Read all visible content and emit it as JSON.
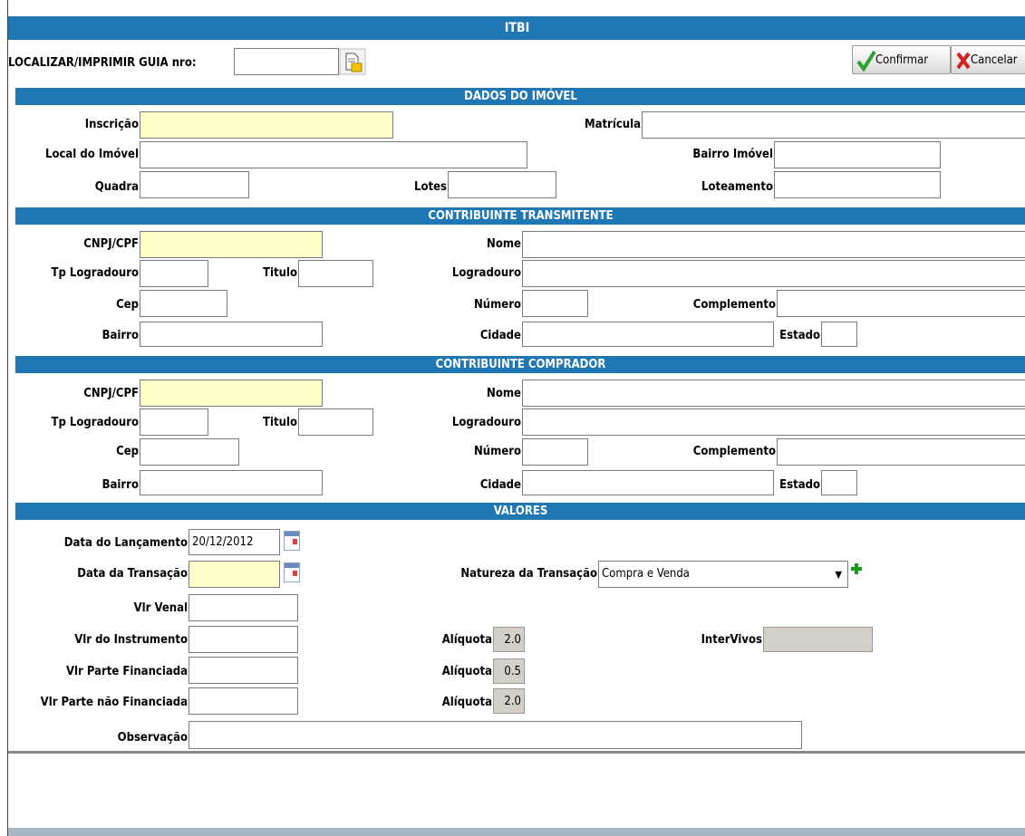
{
  "window": {
    "title": "ITBI"
  },
  "toolbar": {
    "locate_label": "LOCALIZAR/IMPRIMIR GUIA nro:",
    "guide_number": "",
    "confirm_label": "Confirmar",
    "cancel_label": "Cancelar"
  },
  "sections": {
    "imovel": "DADOS DO IMÓVEL",
    "transmitente": "CONTRIBUINTE TRANSMITENTE",
    "comprador": "CONTRIBUINTE COMPRADOR",
    "valores": "VALORES"
  },
  "imovel": {
    "inscricao_label": "Inscrição",
    "inscricao": "",
    "matricula_label": "Matrícula",
    "matricula": "",
    "local_label": "Local do Imóvel",
    "local": "",
    "bairro_label": "Bairro Imóvel",
    "bairro": "",
    "quadra_label": "Quadra",
    "quadra": "",
    "lotes_label": "Lotes",
    "lotes": "",
    "loteamento_label": "Loteamento",
    "loteamento": ""
  },
  "transmitente": {
    "cnpj_label": "CNPJ/CPF",
    "cnpj": "",
    "nome_label": "Nome",
    "nome": "",
    "tp_logradouro_label": "Tp Logradouro",
    "tp_logradouro": "",
    "titulo_label": "Titulo",
    "titulo": "",
    "logradouro_label": "Logradouro",
    "logradouro": "",
    "cep_label": "Cep",
    "cep": "",
    "numero_label": "Número",
    "numero": "",
    "complemento_label": "Complemento",
    "complemento": "",
    "bairro_label": "Bairro",
    "bairro": "",
    "cidade_label": "Cidade",
    "cidade": "",
    "estado_label": "Estado",
    "estado": ""
  },
  "comprador": {
    "cnpj_label": "CNPJ/CPF",
    "cnpj": "",
    "nome_label": "Nome",
    "nome": "",
    "tp_logradouro_label": "Tp Logradouro",
    "tp_logradouro": "",
    "titulo_label": "Titulo",
    "titulo": "",
    "logradouro_label": "Logradouro",
    "logradouro": "",
    "cep_label": "Cep",
    "cep": "",
    "numero_label": "Número",
    "numero": "",
    "complemento_label": "Complemento",
    "complemento": "",
    "bairro_label": "Bairro",
    "bairro": "",
    "cidade_label": "Cidade",
    "cidade": "",
    "estado_label": "Estado",
    "estado": ""
  },
  "valores": {
    "data_lancamento_label": "Data do Lançamento",
    "data_lancamento": "20/12/2012",
    "data_transacao_label": "Data da Transação",
    "data_transacao": "",
    "natureza_label": "Natureza da Transação",
    "natureza": "Compra e Venda",
    "vlr_venal_label": "Vlr Venal",
    "vlr_venal": "",
    "vlr_instrumento_label": "Vlr do Instrumento",
    "vlr_instrumento": "",
    "vlr_financiada_label": "Vlr Parte Financiada",
    "vlr_financiada": "",
    "vlr_nao_financiada_label": "Vlr Parte não Financiada",
    "vlr_nao_financiada": "",
    "aliquota_label": "Alíquota",
    "aliquota_1": "2.0",
    "aliquota_2": "0.5",
    "aliquota_3": "2.0",
    "intervivos_label": "InterVivos",
    "intervivos": "",
    "observacao_label": "Observação",
    "observacao": ""
  },
  "colors": {
    "header_blue": "#1f78b4",
    "required_yellow": "#ffffcc",
    "readonly_gray": "#d4d0c8"
  },
  "icons": [
    "search-doc-icon",
    "check-icon",
    "x-icon",
    "calendar-icon",
    "dropdown-arrow-icon",
    "plus-icon"
  ]
}
